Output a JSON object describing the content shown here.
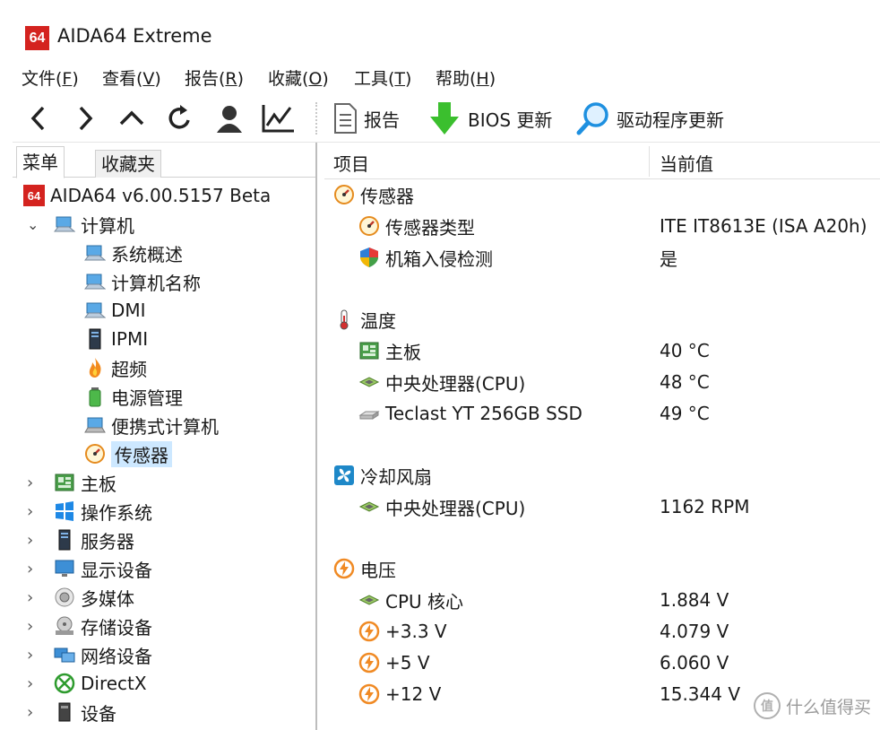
{
  "window": {
    "logo_text": "64",
    "title": "AIDA64 Extreme"
  },
  "menubar": [
    {
      "label": "文件(",
      "key": "F",
      "end": ")"
    },
    {
      "label": "查看(",
      "key": "V",
      "end": ")"
    },
    {
      "label": "报告(",
      "key": "R",
      "end": ")"
    },
    {
      "label": "收藏(",
      "key": "O",
      "end": ")"
    },
    {
      "label": "工具(",
      "key": "T",
      "end": ")"
    },
    {
      "label": "帮助(",
      "key": "H",
      "end": ")"
    }
  ],
  "toolbar": {
    "report_label": "报告",
    "bios_label": "BIOS 更新",
    "driver_label": "驱动程序更新"
  },
  "tabs": {
    "menu": "菜单",
    "favorites": "收藏夹"
  },
  "tree": {
    "root": "AIDA64 v6.00.5157 Beta",
    "computer": "计算机",
    "computer_children": [
      "系统概述",
      "计算机名称",
      "DMI",
      "IPMI",
      "超频",
      "电源管理",
      "便携式计算机",
      "传感器"
    ],
    "top_level": [
      "主板",
      "操作系统",
      "服务器",
      "显示设备",
      "多媒体",
      "存储设备",
      "网络设备",
      "DirectX",
      "设备"
    ]
  },
  "columns": {
    "item": "项目",
    "value": "当前值"
  },
  "groups": {
    "sensors": {
      "title": "传感器",
      "rows": [
        {
          "label": "传感器类型",
          "value": "ITE IT8613E  (ISA A20h)"
        },
        {
          "label": "机箱入侵检测",
          "value": "是"
        }
      ]
    },
    "temperature": {
      "title": "温度",
      "rows": [
        {
          "label": "主板",
          "value": "40 °C"
        },
        {
          "label": "中央处理器(CPU)",
          "value": "48 °C"
        },
        {
          "label": "Teclast YT 256GB SSD",
          "value": "49 °C"
        }
      ]
    },
    "fans": {
      "title": "冷却风扇",
      "rows": [
        {
          "label": "中央处理器(CPU)",
          "value": "1162 RPM"
        }
      ]
    },
    "voltage": {
      "title": "电压",
      "rows": [
        {
          "label": "CPU 核心",
          "value": "1.884 V"
        },
        {
          "label": "+3.3 V",
          "value": "4.079 V"
        },
        {
          "label": "+5 V",
          "value": "6.060 V"
        },
        {
          "label": "+12 V",
          "value": "15.344 V"
        }
      ]
    }
  },
  "watermark": {
    "badge": "值",
    "text": "什么值得买"
  },
  "colors": {
    "accent_red": "#d4231f",
    "selection": "#cde8ff",
    "green_arrow": "#3bbf2e",
    "voltage_orange": "#f08a24"
  }
}
